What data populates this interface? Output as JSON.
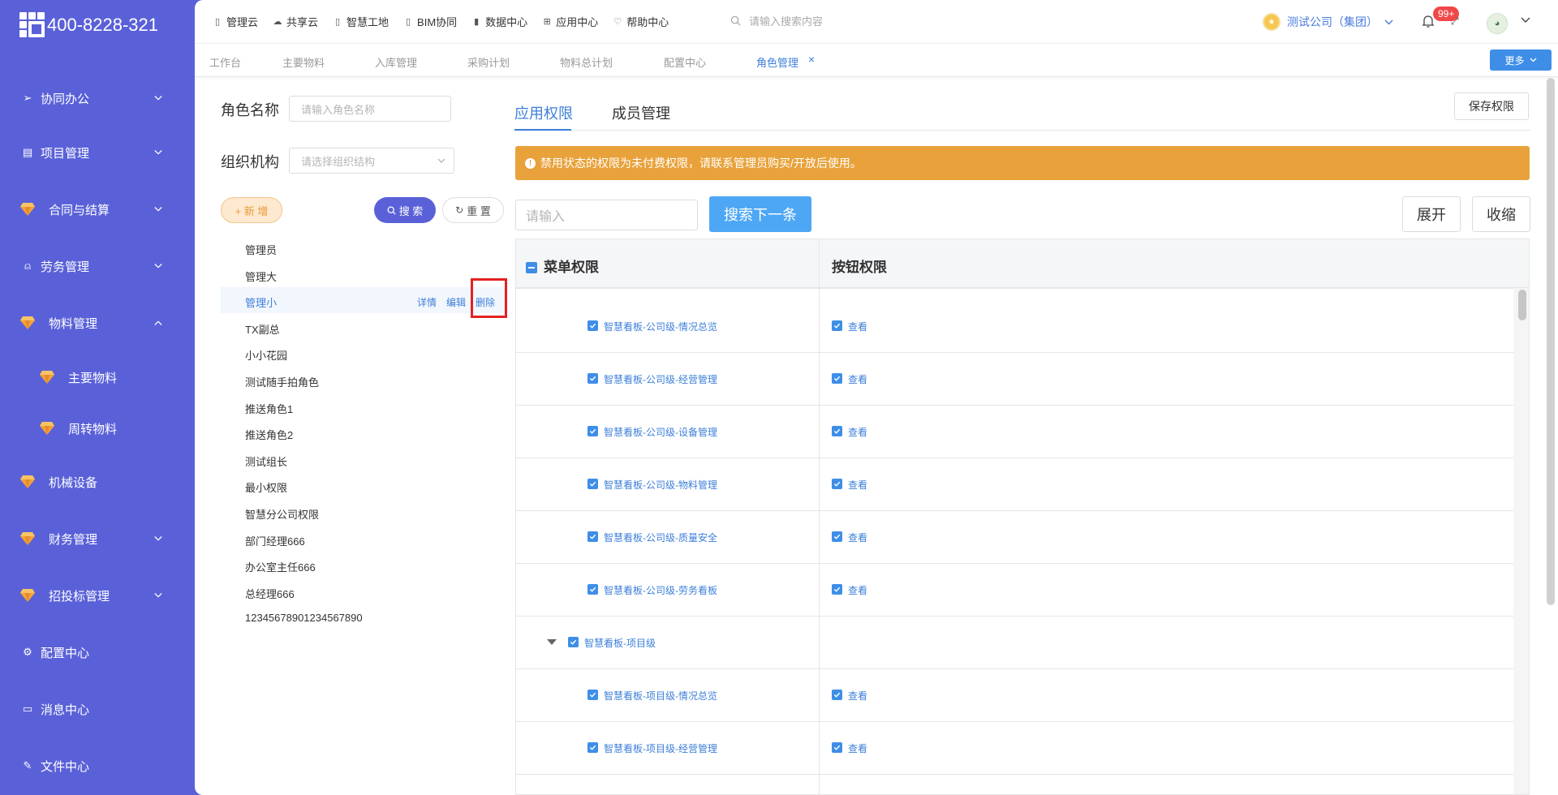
{
  "brand": {
    "phone": "400-8228-321"
  },
  "sidebar": {
    "items": [
      {
        "label": "协同办公",
        "icon": "send-icon"
      },
      {
        "label": "项目管理",
        "icon": "book-icon"
      },
      {
        "label": "合同与结算",
        "icon": "gem-icon"
      },
      {
        "label": "劳务管理",
        "icon": "user-icon"
      },
      {
        "label": "物料管理",
        "icon": "gem-icon"
      },
      {
        "label": "主要物料",
        "icon": "gem-icon"
      },
      {
        "label": "周转物料",
        "icon": "gem-icon"
      },
      {
        "label": "机械设备",
        "icon": "gem-icon"
      },
      {
        "label": "财务管理",
        "icon": "gem-icon"
      },
      {
        "label": "招投标管理",
        "icon": "gem-icon"
      },
      {
        "label": "配置中心",
        "icon": "gear-icon"
      },
      {
        "label": "消息中心",
        "icon": "message-icon"
      },
      {
        "label": "文件中心",
        "icon": "edit-icon"
      }
    ]
  },
  "topbar": {
    "links": [
      "管理云",
      "共享云",
      "智慧工地",
      "BIM协同",
      "数据中心",
      "应用中心",
      "帮助中心"
    ],
    "search_placeholder": "请输入搜索内容",
    "company": "测试公司（集团）",
    "badge": "99+"
  },
  "tabs": {
    "items": [
      "工作台",
      "主要物料",
      "入库管理",
      "采购计划",
      "物料总计划",
      "配置中心",
      "角色管理"
    ],
    "active": "角色管理",
    "more": "更多"
  },
  "left": {
    "role_name_label": "角色名称",
    "role_name_placeholder": "请输入角色名称",
    "org_label": "组织机构",
    "org_placeholder": "请选择组织结构",
    "add_button": "+ 新 增",
    "search_button": "搜 索",
    "reset_button": "重 置",
    "roles": [
      "管理员",
      "管理大",
      "管理小",
      "TX副总",
      "小小花园",
      "测试随手拍角色",
      "推送角色1",
      "推送角色2",
      "测试组长",
      "最小权限",
      "智慧分公司权限",
      "部门经理666",
      "办公室主任666",
      "总经理666",
      "12345678901234567890"
    ],
    "selected_role": "管理小",
    "actions": [
      "详情",
      "编辑",
      "删除"
    ]
  },
  "right": {
    "tabs": [
      "应用权限",
      "成员管理"
    ],
    "save_button": "保存权限",
    "notice": "禁用状态的权限为未付费权限，请联系管理员购买/开放后使用。",
    "search_placeholder": "请输入",
    "next_button": "搜索下一条",
    "expand_button": "展开",
    "collapse_button": "收缩",
    "columns": [
      "菜单权限",
      "按钮权限"
    ],
    "rows": [
      {
        "menu": "智慧看板-公司级-情况总览",
        "button": "查看",
        "level": 2
      },
      {
        "menu": "智慧看板-公司级-经营管理",
        "button": "查看",
        "level": 2
      },
      {
        "menu": "智慧看板-公司级-设备管理",
        "button": "查看",
        "level": 2
      },
      {
        "menu": "智慧看板-公司级-物料管理",
        "button": "查看",
        "level": 2
      },
      {
        "menu": "智慧看板-公司级-质量安全",
        "button": "查看",
        "level": 2
      },
      {
        "menu": "智慧看板-公司级-劳务看板",
        "button": "查看",
        "level": 2
      },
      {
        "menu": "智慧看板-项目级",
        "button": "",
        "level": 1
      },
      {
        "menu": "智慧看板-项目级-情况总览",
        "button": "查看",
        "level": 2
      },
      {
        "menu": "智慧看板-项目级-经营管理",
        "button": "查看",
        "level": 2
      }
    ]
  },
  "colors": {
    "sidebar": "#5a61d8",
    "accent": "#3d7fd9",
    "notice": "#e9a23b",
    "highlight": "#e32121"
  }
}
